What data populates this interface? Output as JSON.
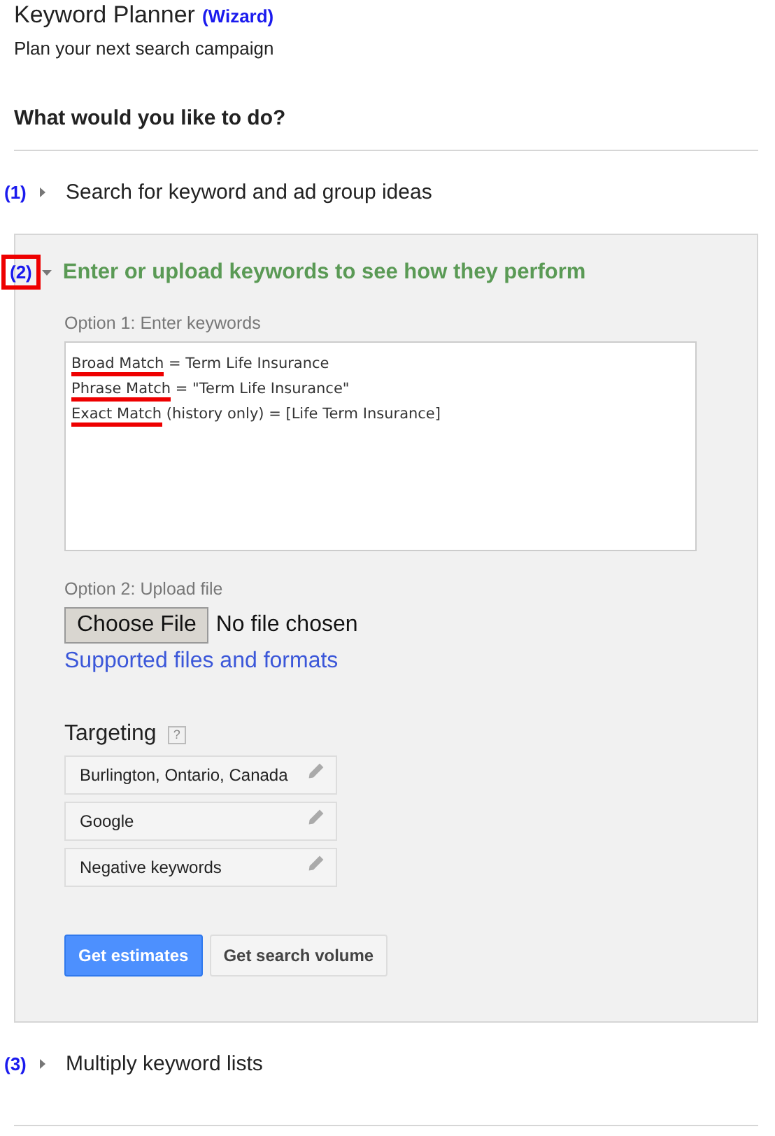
{
  "header": {
    "title": "Keyword Planner",
    "badge": "(Wizard)",
    "subtitle": "Plan your next search campaign"
  },
  "question": "What would you like to do?",
  "sections": [
    {
      "marker": "(1)",
      "title": "Search for keyword and ad group ideas",
      "expanded": false,
      "highlighted": false
    },
    {
      "marker": "(2)",
      "title": "Enter or upload keywords to see how they perform",
      "expanded": true,
      "highlighted": true,
      "option1_label": "Option 1: Enter keywords",
      "keyword_lines": [
        {
          "term": "Broad Match",
          "rest": " = Term Life Insurance"
        },
        {
          "term": "Phrase Match",
          "rest": " = \"Term Life Insurance\""
        },
        {
          "term": "Exact Match",
          "rest": " (history only) = [Life Term Insurance]"
        }
      ],
      "option2_label": "Option 2: Upload file",
      "file_button": "Choose File",
      "file_status": "No file chosen",
      "formats_link": "Supported files and formats",
      "targeting_label": "Targeting",
      "help": "?",
      "targeting": [
        "Burlington, Ontario, Canada",
        "Google",
        "Negative keywords"
      ],
      "buttons": [
        {
          "label": "Get estimates",
          "kind": "primary"
        },
        {
          "label": "Get search volume",
          "kind": "secondary"
        }
      ]
    },
    {
      "marker": "(3)",
      "title": "Multiply keyword lists",
      "expanded": false,
      "highlighted": false
    }
  ]
}
